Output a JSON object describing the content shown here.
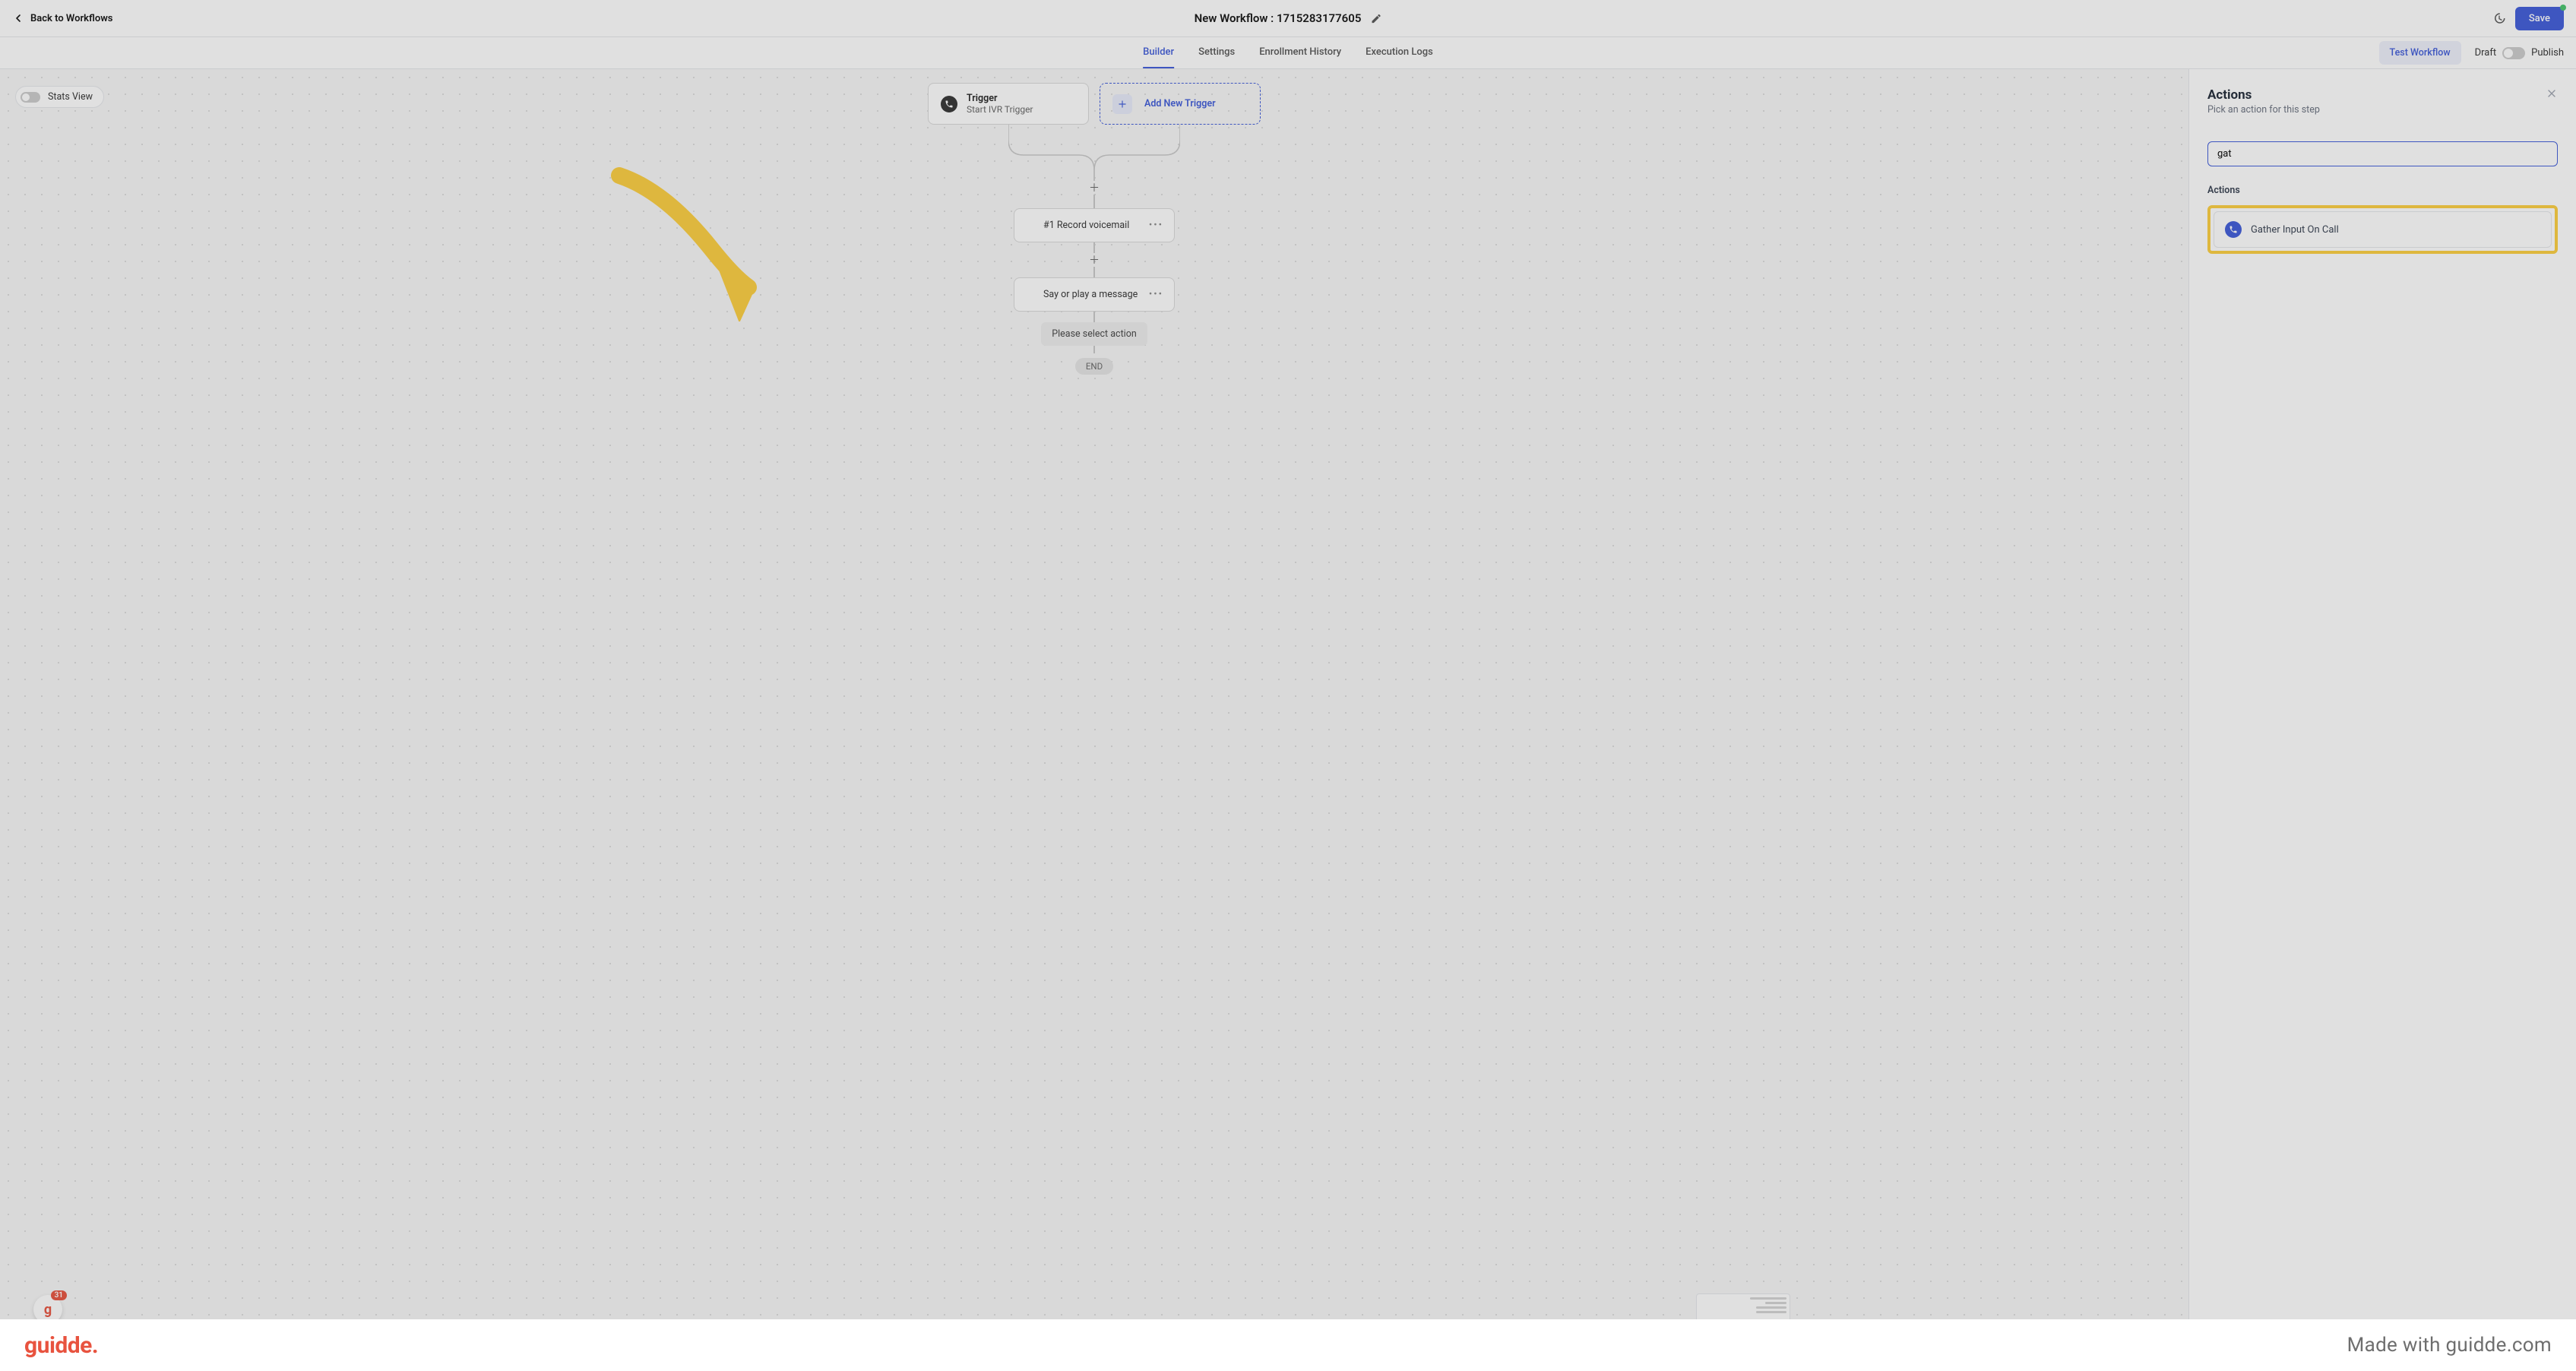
{
  "header": {
    "back_label": "Back to Workflows",
    "title": "New Workflow : 1715283177605",
    "save_label": "Save"
  },
  "tabs": {
    "items": [
      "Builder",
      "Settings",
      "Enrollment History",
      "Execution Logs"
    ],
    "active_index": 0,
    "test_label": "Test Workflow",
    "draft_label": "Draft",
    "publish_label": "Publish"
  },
  "canvas": {
    "stats_view_label": "Stats View",
    "trigger": {
      "title": "Trigger",
      "subtitle": "Start IVR Trigger"
    },
    "add_trigger_label": "Add New Trigger",
    "nodes": [
      {
        "label": "#1 Record voicemail"
      },
      {
        "label": "Say or play a message"
      }
    ],
    "select_action_label": "Please select action",
    "end_label": "END"
  },
  "sidebar": {
    "title": "Actions",
    "subtitle": "Pick an action for this step",
    "search_value": "gat",
    "section_label": "Actions",
    "results": [
      {
        "label": "Gather Input On Call"
      }
    ]
  },
  "fab": {
    "badge": "31"
  },
  "footer": {
    "brand": "guidde.",
    "tagline": "Made with guidde.com"
  }
}
